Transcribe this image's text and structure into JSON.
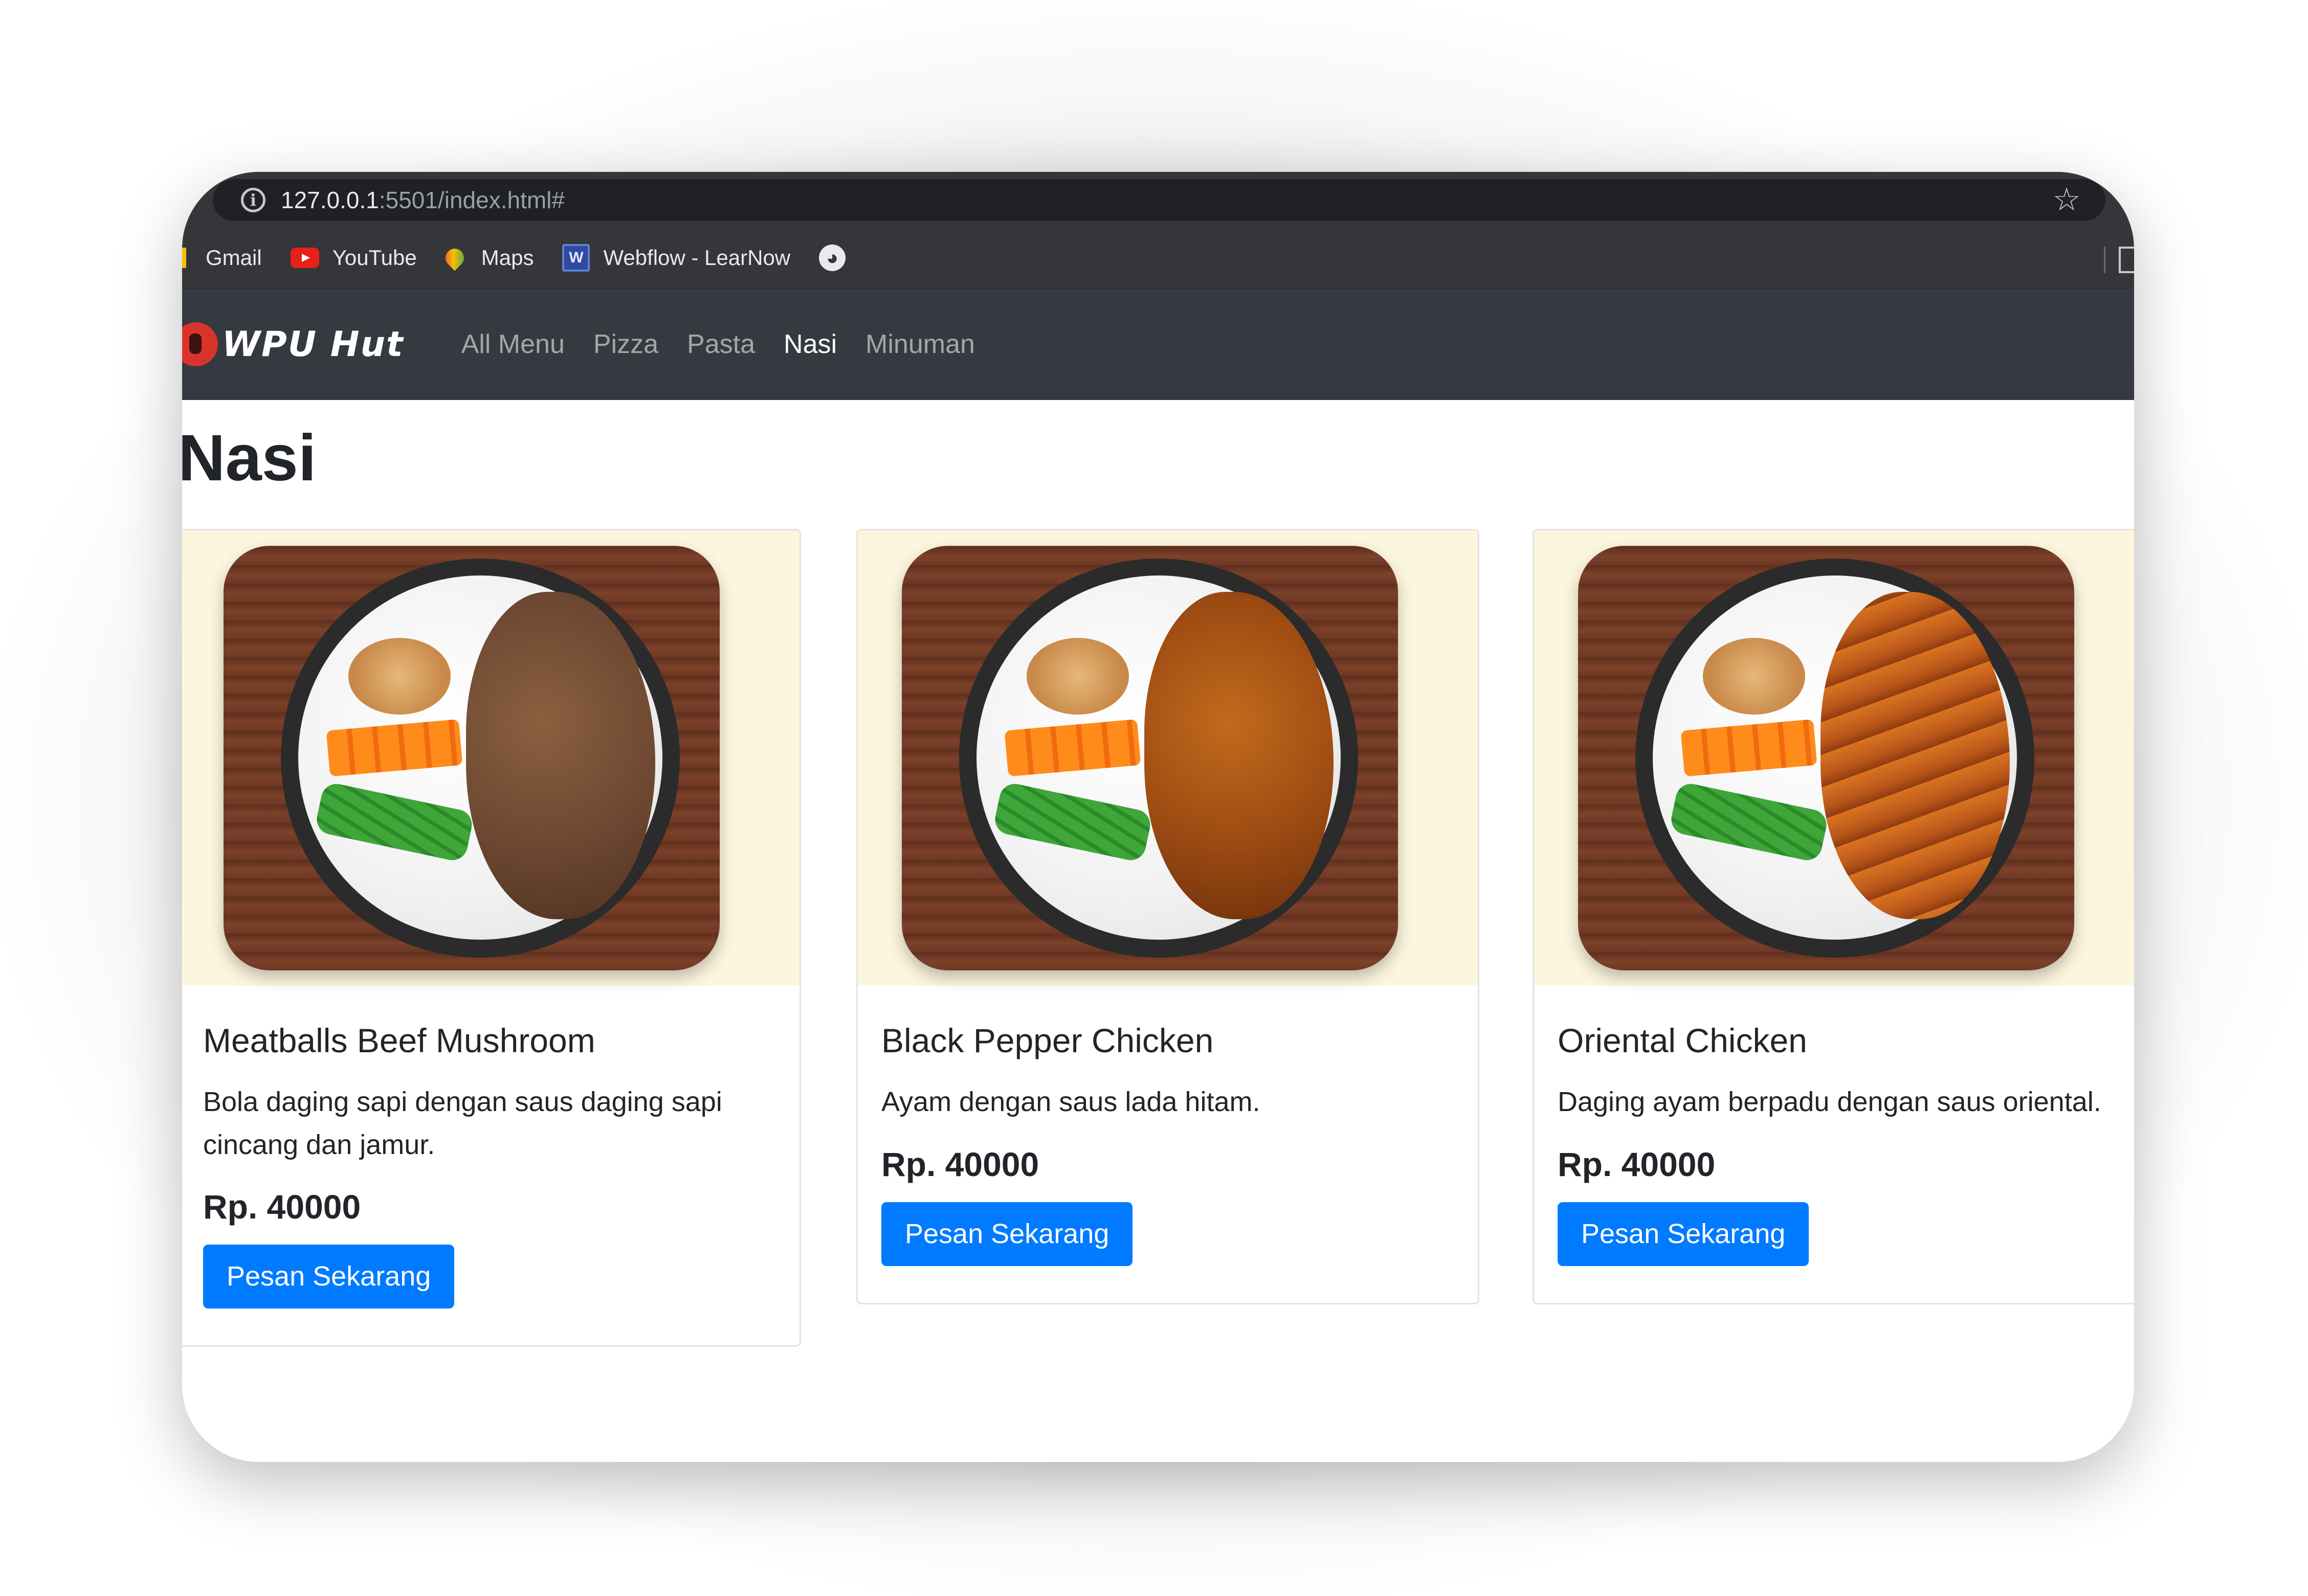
{
  "browser": {
    "url_host": "127.0.0.1",
    "url_rest": ":5501/index.html#",
    "bookmarks": [
      {
        "label": "Gmail",
        "icon": "gmail-icon"
      },
      {
        "label": "YouTube",
        "icon": "youtube-icon"
      },
      {
        "label": "Maps",
        "icon": "maps-icon"
      },
      {
        "label": "Webflow - LearNow",
        "icon": "webflow-icon"
      }
    ]
  },
  "navbar": {
    "brand": "WPU Hut",
    "links": [
      {
        "label": "All Menu",
        "active": false
      },
      {
        "label": "Pizza",
        "active": false
      },
      {
        "label": "Pasta",
        "active": false
      },
      {
        "label": "Nasi",
        "active": true
      },
      {
        "label": "Minuman",
        "active": false
      }
    ]
  },
  "page": {
    "title": "Nasi"
  },
  "cards": [
    {
      "title": "Meatballs Beef Mushroom",
      "description": "Bola daging sapi dengan saus daging sapi cincang dan jamur.",
      "price": "Rp. 40000",
      "button": "Pesan Sekarang"
    },
    {
      "title": "Black Pepper Chicken",
      "description": "Ayam dengan saus lada hitam.",
      "price": "Rp. 40000",
      "button": "Pesan Sekarang"
    },
    {
      "title": "Oriental Chicken",
      "description": "Daging ayam berpadu dengan saus oriental.",
      "price": "Rp. 40000",
      "button": "Pesan Sekarang"
    }
  ],
  "colors": {
    "navbar_bg": "#343a40",
    "button_primary": "#007bff",
    "image_bg": "#fdf6df"
  }
}
